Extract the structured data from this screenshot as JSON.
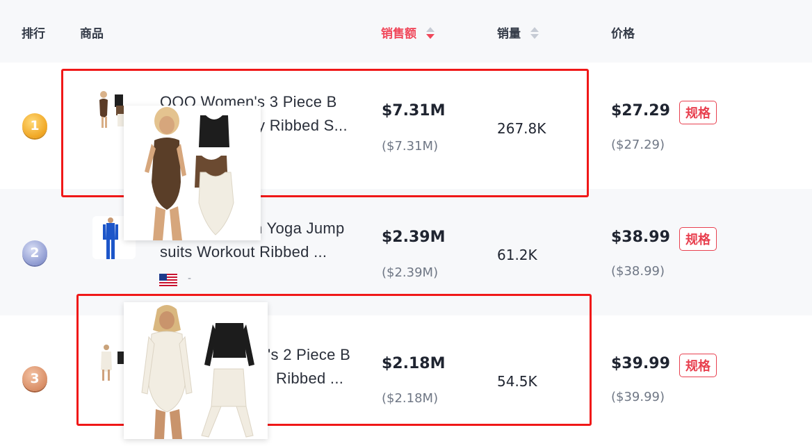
{
  "header": {
    "rank": "排行",
    "product": "商品",
    "sales_amount": "销售额",
    "sales_volume": "销量",
    "price": "价格"
  },
  "colors": {
    "accent": "#f0475a",
    "highlight_box": "#f01818",
    "row_alt_bg": "#f7f8fa"
  },
  "rows": [
    {
      "rank": "1",
      "medal": "gold-medal-icon",
      "title_line1": "OQQ Women's 3 Piece B",
      "title_line2": "y Ribbed S...",
      "amount": "$7.31M",
      "amount_sub": "($7.31M)",
      "volume": "267.8K",
      "price": "$27.29",
      "price_sub": "($27.29)",
      "spec": "规格"
    },
    {
      "rank": "2",
      "medal": "silver-medal-icon",
      "title_line1": "n Yoga Jump",
      "title_line2": "suits Workout Ribbed ...",
      "flag": "us-flag-icon",
      "flag_suffix": "-",
      "amount": "$2.39M",
      "amount_sub": "($2.39M)",
      "volume": "61.2K",
      "price": "$38.99",
      "price_sub": "($38.99)",
      "spec": "规格"
    },
    {
      "rank": "3",
      "medal": "bronze-medal-icon",
      "title_line1": "'s 2 Piece B",
      "title_line2": "Ribbed ...",
      "amount": "$2.18M",
      "amount_sub": "($2.18M)",
      "volume": "54.5K",
      "price": "$39.99",
      "price_sub": "($39.99)",
      "spec": "规格"
    }
  ]
}
